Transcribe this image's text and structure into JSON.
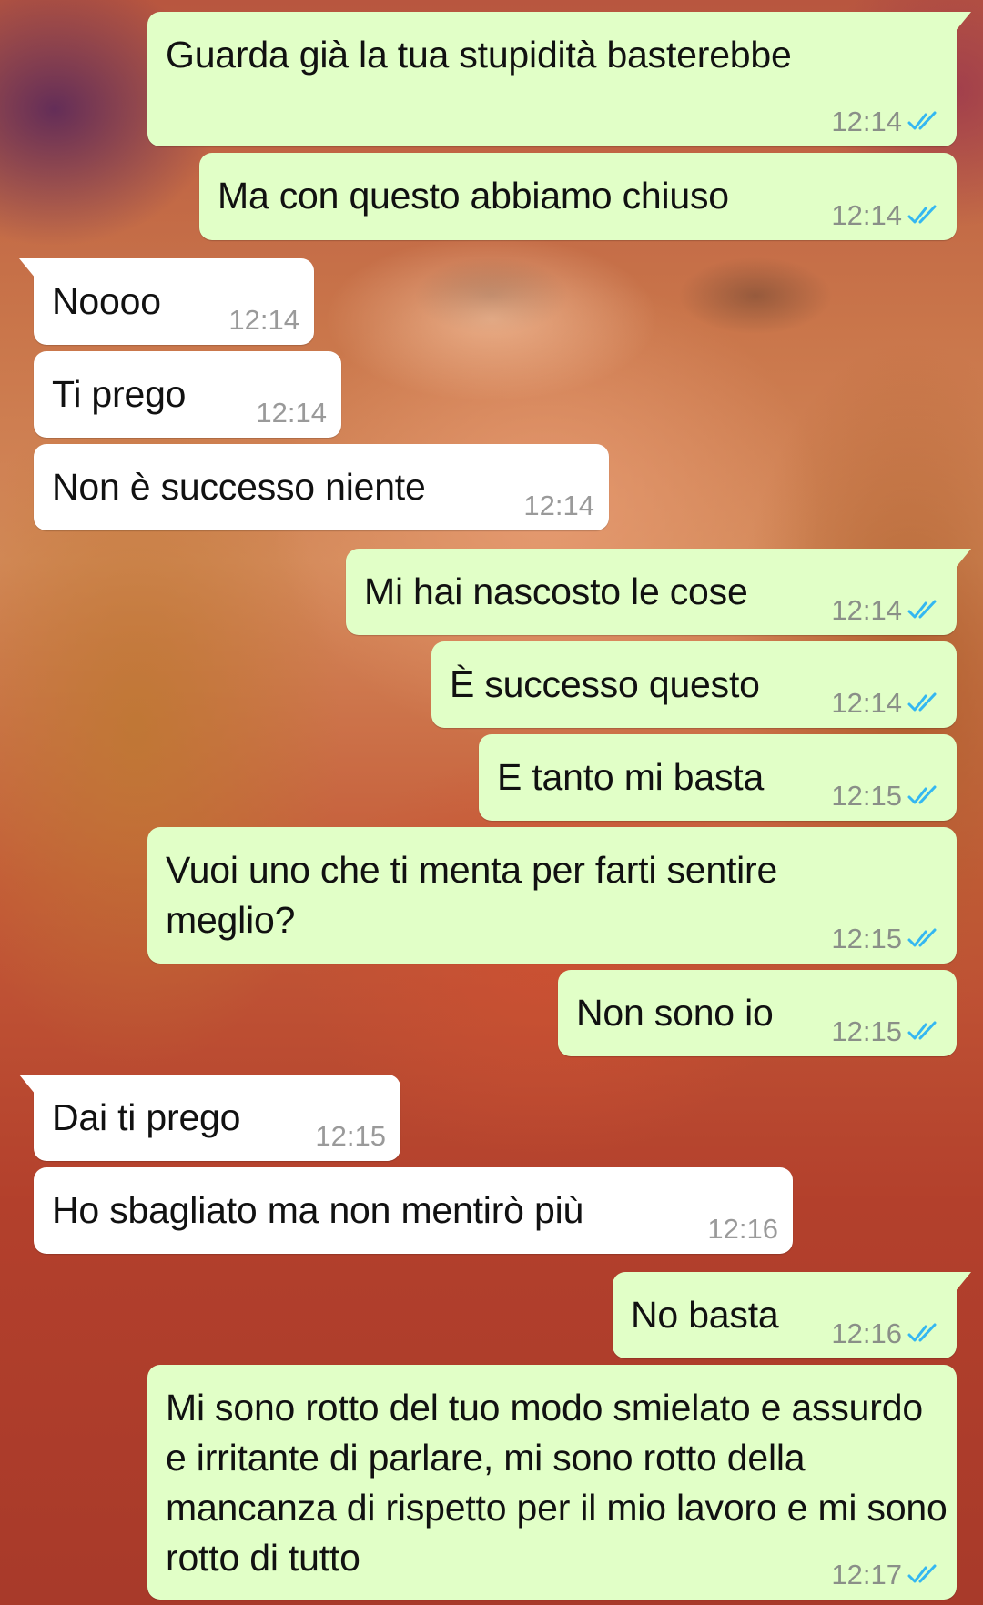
{
  "conversation": {
    "messages": [
      {
        "dir": "out",
        "text": "Guarda già la tua stupidità basterebbe",
        "time": "12:14",
        "read": true
      },
      {
        "dir": "out",
        "text": "Ma con questo abbiamo chiuso",
        "time": "12:14",
        "read": true
      },
      {
        "dir": "in",
        "text": "Noooo",
        "time": "12:14"
      },
      {
        "dir": "in",
        "text": "Ti prego",
        "time": "12:14"
      },
      {
        "dir": "in",
        "text": "Non è successo niente",
        "time": "12:14"
      },
      {
        "dir": "out",
        "text": "Mi hai nascosto le cose",
        "time": "12:14",
        "read": true
      },
      {
        "dir": "out",
        "text": "È successo questo",
        "time": "12:14",
        "read": true
      },
      {
        "dir": "out",
        "text": "E tanto mi basta",
        "time": "12:15",
        "read": true
      },
      {
        "dir": "out",
        "text": "Vuoi uno che ti menta per farti sentire meglio?",
        "time": "12:15",
        "read": true
      },
      {
        "dir": "out",
        "text": "Non sono io",
        "time": "12:15",
        "read": true
      },
      {
        "dir": "in",
        "text": "Dai ti prego",
        "time": "12:15"
      },
      {
        "dir": "in",
        "text": "Ho sbagliato ma non mentirò più",
        "time": "12:16"
      },
      {
        "dir": "out",
        "text": "No basta",
        "time": "12:16",
        "read": true
      },
      {
        "dir": "out",
        "text": "Mi sono rotto del tuo modo smielato e assurdo e irritante di parlare, mi sono rotto della mancanza di rispetto per il mio lavoro e mi sono rotto di tutto",
        "time": "12:17",
        "read": true
      }
    ]
  },
  "colors": {
    "outgoing_bubble": "#e1ffc7",
    "incoming_bubble": "#ffffff",
    "read_ticks": "#34b7f1",
    "timestamp": "#8a8f88"
  },
  "icons": {
    "read_receipt": "double-check-icon"
  }
}
